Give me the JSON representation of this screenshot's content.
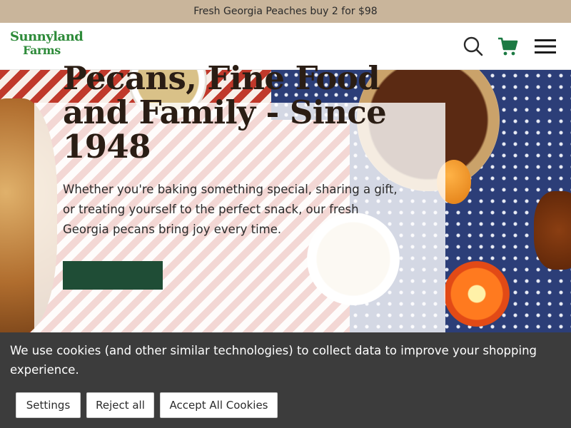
{
  "promo": {
    "text": "Fresh Georgia Peaches buy 2 for $98"
  },
  "header": {
    "logo_line1": "Sunnyland",
    "logo_line2": "Farms",
    "icons": {
      "search": "search-icon",
      "cart": "cart-icon",
      "menu": "menu-icon"
    },
    "accent_color": "#1c7a43"
  },
  "hero": {
    "title": "Pecans, Fine Food and Family - Since 1948",
    "body": "Whether you're baking something special, sharing a gift, or treating yourself to the perfect snack, our fresh Georgia pecans bring joy every time."
  },
  "cookie_banner": {
    "message": "We use cookies (and other similar technologies) to collect data to improve your shopping experience.",
    "settings_label": "Settings",
    "reject_label": "Reject all",
    "accept_label": "Accept All Cookies"
  }
}
